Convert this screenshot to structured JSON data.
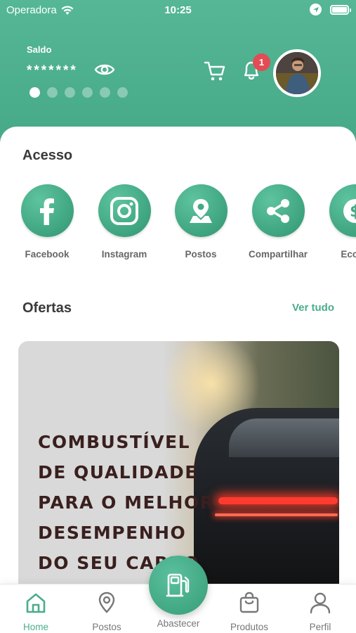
{
  "status_bar": {
    "carrier": "Operadora",
    "time": "10:25"
  },
  "header": {
    "balance_label": "Saldo",
    "balance_value": "*******",
    "carousel_dots": 6,
    "carousel_active_index": 0,
    "notification_count": "1"
  },
  "acesso": {
    "title": "Acesso",
    "items": [
      {
        "label": "Facebook",
        "icon": "facebook-icon"
      },
      {
        "label": "Instagram",
        "icon": "instagram-icon"
      },
      {
        "label": "Postos",
        "icon": "map-pin-icon"
      },
      {
        "label": "Compartilhar",
        "icon": "share-icon"
      },
      {
        "label": "Econo",
        "icon": "dollar-icon"
      }
    ]
  },
  "ofertas": {
    "title": "Ofertas",
    "see_all": "Ver tudo",
    "banner_lines": [
      "COMBUSTÍVEL",
      "DE QUALIDADE",
      "PARA O MELHOR",
      "DESEMPENHO",
      "DO SEU CARRO"
    ]
  },
  "tabbar": {
    "home": "Home",
    "postos": "Postos",
    "abastecer": "Abastecer",
    "produtos": "Produtos",
    "perfil": "Perfil"
  },
  "colors": {
    "accent": "#4aad8b",
    "badge": "#e24c55"
  }
}
